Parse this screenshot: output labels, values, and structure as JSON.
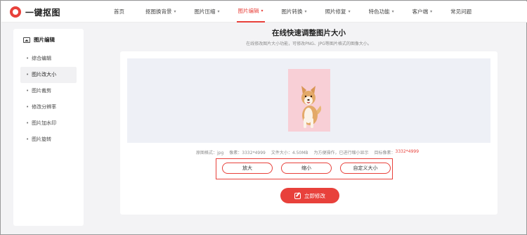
{
  "brand": {
    "name": "一键抠图"
  },
  "nav": {
    "items": [
      {
        "label": "首页",
        "dropdown": false,
        "active": false
      },
      {
        "label": "抠图换背景",
        "dropdown": true,
        "active": false
      },
      {
        "label": "图片压缩",
        "dropdown": true,
        "active": false
      },
      {
        "label": "图片编辑",
        "dropdown": true,
        "active": true
      },
      {
        "label": "图片转换",
        "dropdown": true,
        "active": false
      },
      {
        "label": "照片修复",
        "dropdown": true,
        "active": false
      },
      {
        "label": "特色功能",
        "dropdown": true,
        "active": false
      },
      {
        "label": "客户端",
        "dropdown": true,
        "active": false
      },
      {
        "label": "常见问题",
        "dropdown": false,
        "active": false
      }
    ],
    "chevron": "▾"
  },
  "sidebar": {
    "heading": "图片编辑",
    "items": [
      {
        "label": "综合编辑",
        "active": false
      },
      {
        "label": "图片改大小",
        "active": true
      },
      {
        "label": "图片裁剪",
        "active": false
      },
      {
        "label": "修改分辨率",
        "active": false
      },
      {
        "label": "图片加水印",
        "active": false
      },
      {
        "label": "图片旋转",
        "active": false
      }
    ]
  },
  "main": {
    "title": "在线快速调整图片大小",
    "subtitle": "在线修改图片大小功能，可修改PNG、JPG等图片格式的图像大小。",
    "info": {
      "format": "原图格式：jpg",
      "pixels": "像素：3332*4999",
      "filesize": "文件大小：4.50MB",
      "note": "为方便操作，已进行缩小显示",
      "target_label": "目标像素：",
      "target_value": "3332*4999"
    },
    "options": [
      "放大",
      "缩小",
      "自定义大小"
    ],
    "apply_label": "立即修改"
  },
  "colors": {
    "accent": "#e8413b",
    "preview_bg": "#eef0f6",
    "photo_bg": "#f8cfd6"
  }
}
